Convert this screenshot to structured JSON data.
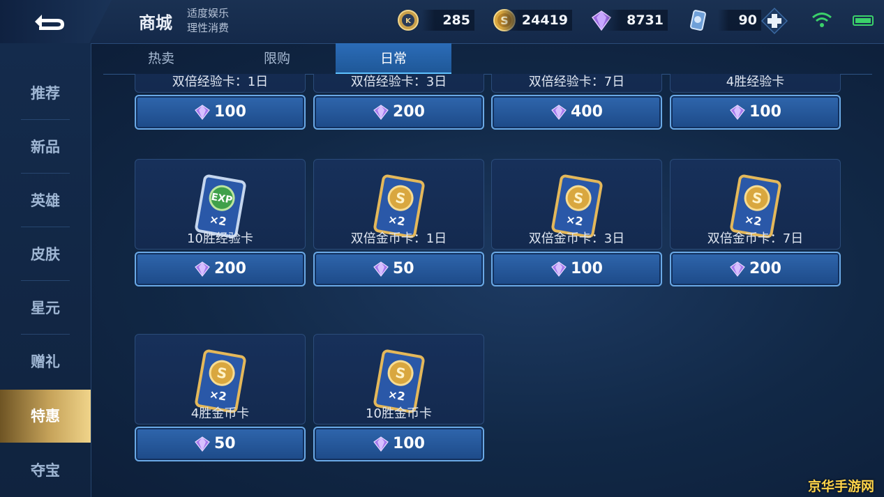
{
  "header": {
    "title": "商城",
    "subtitle_line1": "适度娱乐",
    "subtitle_line2": "理性消费",
    "currencies": [
      {
        "icon": "coupon-icon",
        "amount": "285"
      },
      {
        "icon": "gold-coin-icon",
        "amount": "24419"
      },
      {
        "icon": "diamond-icon",
        "amount": "8731"
      },
      {
        "icon": "ticket-card-icon",
        "amount": "90"
      }
    ]
  },
  "sidebar": {
    "items": [
      {
        "label": "推荐"
      },
      {
        "label": "新品"
      },
      {
        "label": "英雄"
      },
      {
        "label": "皮肤"
      },
      {
        "label": "星元"
      },
      {
        "label": "赠礼"
      },
      {
        "label": "特惠",
        "active": true
      },
      {
        "label": "夺宝"
      }
    ]
  },
  "tabs": [
    {
      "label": "热卖"
    },
    {
      "label": "限购"
    },
    {
      "label": "日常",
      "active": true
    }
  ],
  "products": [
    {
      "name": "双倍经验卡：1日",
      "price": "100",
      "icon": "none"
    },
    {
      "name": "双倍经验卡：3日",
      "price": "200",
      "icon": "none"
    },
    {
      "name": "双倍经验卡：7日",
      "price": "400",
      "icon": "none"
    },
    {
      "name": "4胜经验卡",
      "price": "100",
      "icon": "none"
    },
    {
      "name": "10胜经验卡",
      "price": "200",
      "icon": "exp-card-icon",
      "icon_text": "EXP",
      "icon_mult": "×2"
    },
    {
      "name": "双倍金币卡：1日",
      "price": "50",
      "icon": "gold-card-icon",
      "icon_text": "S",
      "icon_mult": "×2"
    },
    {
      "name": "双倍金币卡：3日",
      "price": "100",
      "icon": "gold-card-icon",
      "icon_text": "S",
      "icon_mult": "×2"
    },
    {
      "name": "双倍金币卡：7日",
      "price": "200",
      "icon": "gold-card-icon",
      "icon_text": "S",
      "icon_mult": "×2"
    },
    {
      "name": "4胜金币卡",
      "price": "50",
      "icon": "gold-card-icon",
      "icon_text": "S",
      "icon_mult": "×2"
    },
    {
      "name": "10胜金币卡",
      "price": "100",
      "icon": "gold-card-icon",
      "icon_text": "S",
      "icon_mult": "×2"
    }
  ],
  "watermark": "京华手游网",
  "colors": {
    "accent": "#5fc2ff",
    "active_sidebar": "#c6a35a",
    "price_button": "#2f66ad"
  }
}
